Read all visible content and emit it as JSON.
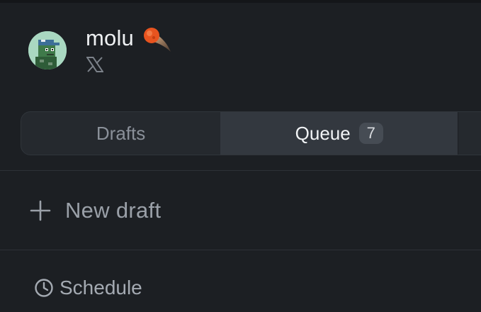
{
  "profile": {
    "username": "molu",
    "username_icon": "comet-icon",
    "platform_icon": "x-logo-icon",
    "avatar_icon": "pixel-avatar"
  },
  "tabs": [
    {
      "label": "Drafts",
      "active": false
    },
    {
      "label": "Queue",
      "active": true,
      "badge": "7"
    }
  ],
  "actions": {
    "new_draft_label": "New draft",
    "new_draft_icon": "plus-icon",
    "schedule_label": "Schedule",
    "schedule_icon": "clock-icon"
  },
  "colors": {
    "background": "#1c1f23",
    "active_tab": "#33383f",
    "badge": "#464c54",
    "avatar_bg": "#a9d8c1"
  }
}
